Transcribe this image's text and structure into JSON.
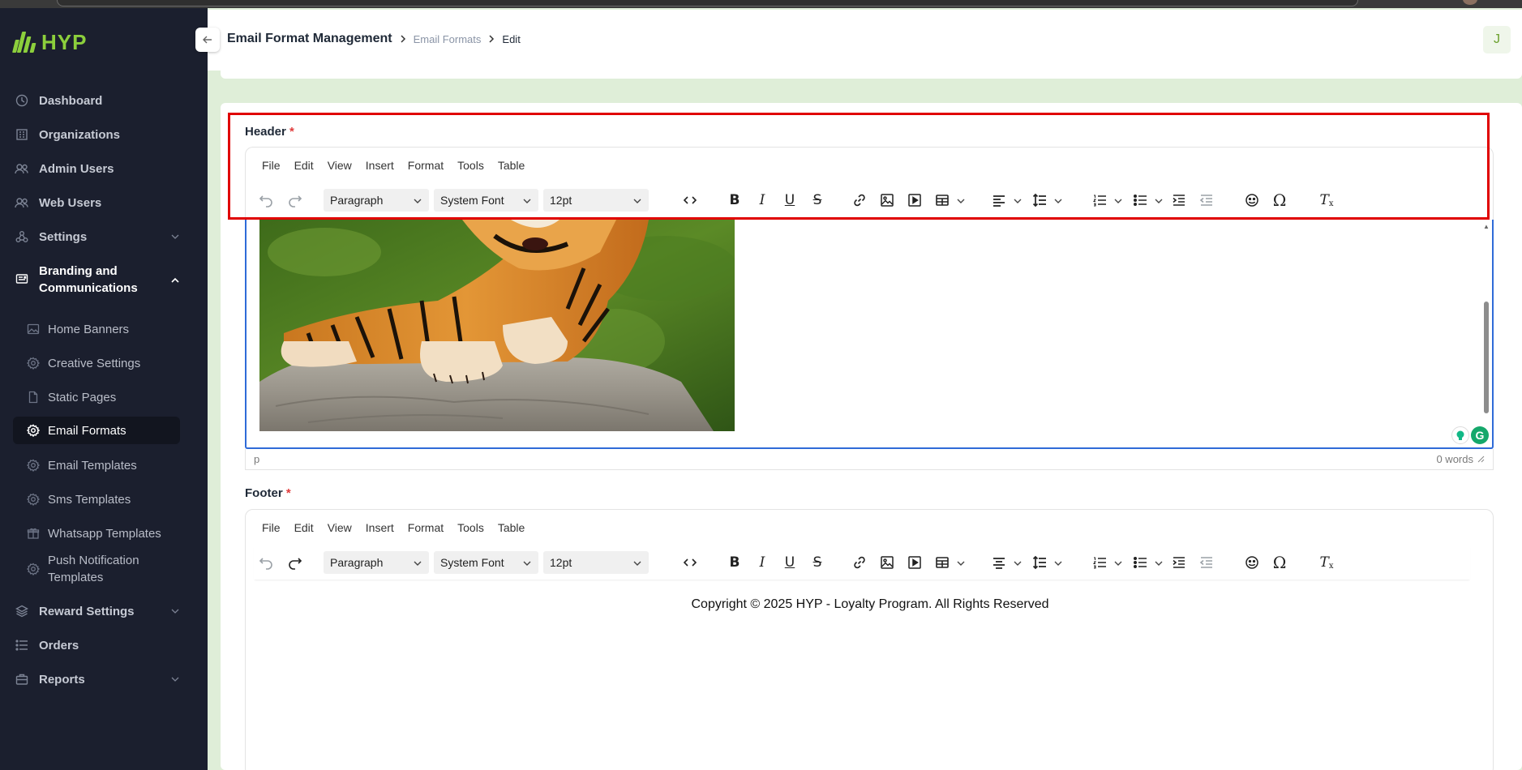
{
  "app": {
    "logo_text": "HYP",
    "accent": "#8ccf3c",
    "sidebar_bg": "#1b1f2e"
  },
  "sidebar": {
    "items": [
      {
        "label": "Dashboard",
        "icon": "clock-icon"
      },
      {
        "label": "Organizations",
        "icon": "building-icon"
      },
      {
        "label": "Admin Users",
        "icon": "users-icon"
      },
      {
        "label": "Web Users",
        "icon": "users-icon"
      },
      {
        "label": "Settings",
        "icon": "nodes-icon",
        "expandable": true
      },
      {
        "label": "Branding and Communications",
        "icon": "newspaper-icon",
        "expanded": true
      },
      {
        "label": "Reward Settings",
        "icon": "layers-icon",
        "expandable": true
      },
      {
        "label": "Orders",
        "icon": "list-icon"
      },
      {
        "label": "Reports",
        "icon": "briefcase-icon",
        "expandable": true
      }
    ],
    "sub_items": [
      {
        "label": "Home Banners",
        "icon": "image-icon"
      },
      {
        "label": "Creative Settings",
        "icon": "gear-icon"
      },
      {
        "label": "Static Pages",
        "icon": "file-icon"
      },
      {
        "label": "Email Formats",
        "icon": "gear-icon",
        "active": true
      },
      {
        "label": "Email Templates",
        "icon": "gear-icon"
      },
      {
        "label": "Sms Templates",
        "icon": "gear-icon"
      },
      {
        "label": "Whatsapp Templates",
        "icon": "gift-icon"
      },
      {
        "label": "Push Notification Templates",
        "icon": "gear-icon"
      }
    ]
  },
  "header": {
    "breadcrumb": [
      "Email Format Management",
      "Email Formats",
      "Edit"
    ],
    "avatar_initial": "J"
  },
  "menubar": [
    "File",
    "Edit",
    "View",
    "Insert",
    "Format",
    "Tools",
    "Table"
  ],
  "selects": {
    "block": "Paragraph",
    "font": "System Font",
    "size": "12pt"
  },
  "header_field": {
    "label": "Header",
    "required": "*",
    "status_path": "p",
    "word_count": "0 words"
  },
  "footer_field": {
    "label": "Footer",
    "required": "*",
    "content": "Copyright © 2025 HYP - Loyalty Program. All Rights Reserved"
  }
}
